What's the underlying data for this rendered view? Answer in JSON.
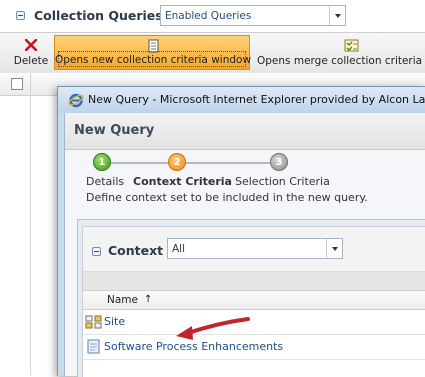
{
  "page": {
    "section_title": "Collection Queries",
    "filter_value": "Enabled Queries"
  },
  "toolbar": {
    "delete_label": "Delete",
    "new_label": "Opens new collection criteria window",
    "merge_label": "Opens merge collection criteria wi"
  },
  "popup": {
    "window_title": "New Query - Microsoft Internet Explorer provided by Alcon Labo",
    "header": "New Query",
    "steps": [
      {
        "number": "1",
        "label": "Details",
        "state": "complete"
      },
      {
        "number": "2",
        "label": "Context Criteria",
        "state": "current"
      },
      {
        "number": "3",
        "label": "Selection Criteria",
        "state": "pending"
      }
    ],
    "instruction": "Define context set to be included in the new query.",
    "context": {
      "title": "Context",
      "filter_value": "All",
      "column_name": "Name",
      "sort_indicator": "↑",
      "rows": [
        {
          "label": "Site",
          "icon": "site-icon"
        },
        {
          "label": "Software Process Enhancements",
          "icon": "document-icon"
        }
      ]
    }
  },
  "colors": {
    "toolbar_selected": "#f6a72c",
    "annotation_arrow": "#c0262a",
    "link_text": "#1f4f86"
  }
}
